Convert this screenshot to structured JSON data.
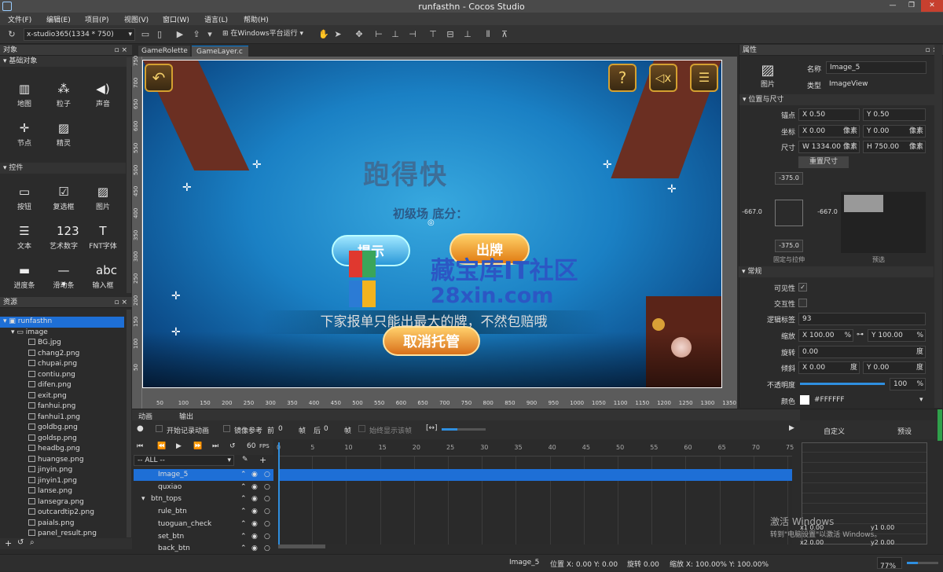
{
  "window": {
    "title": "runfasthn - Cocos Studio",
    "min": "—",
    "max": "❐",
    "close": "✕"
  },
  "menu": [
    "文件(F)",
    "编辑(E)",
    "项目(P)",
    "视图(V)",
    "窗口(W)",
    "语言(L)",
    "帮助(H)"
  ],
  "toolbar": {
    "resolution": "x-studio365(1334 * 750)",
    "run_target": "在Windows平台运行"
  },
  "objects_panel": {
    "title": "对象",
    "sec_basic": "基础对象",
    "basic": [
      {
        "label": "地图",
        "icon": "map-icon",
        "glyph": "▥"
      },
      {
        "label": "粒子",
        "icon": "particle-icon",
        "glyph": "⁂"
      },
      {
        "label": "声音",
        "icon": "sound-icon",
        "glyph": "◀)"
      },
      {
        "label": "节点",
        "icon": "node-icon",
        "glyph": "✛"
      },
      {
        "label": "精灵",
        "icon": "sprite-icon",
        "glyph": "▨"
      }
    ],
    "sec_controls": "控件",
    "controls": [
      {
        "label": "按钮",
        "icon": "button-icon",
        "glyph": "▭"
      },
      {
        "label": "复选框",
        "icon": "checkbox-icon",
        "glyph": "☑"
      },
      {
        "label": "图片",
        "icon": "image-icon",
        "glyph": "▨"
      },
      {
        "label": "文本",
        "icon": "text-icon",
        "glyph": "☰"
      },
      {
        "label": "艺术数字",
        "icon": "art-number-icon",
        "glyph": "123"
      },
      {
        "label": "FNT字体",
        "icon": "fnt-font-icon",
        "glyph": "T"
      },
      {
        "label": "进度条",
        "icon": "progress-icon",
        "glyph": "▬"
      },
      {
        "label": "滑动条",
        "icon": "slider-icon",
        "glyph": "—•"
      },
      {
        "label": "输入框",
        "icon": "input-box-icon",
        "glyph": "abc"
      }
    ]
  },
  "resources_panel": {
    "title": "资源",
    "root": "runfasthn",
    "folder": "image",
    "files": [
      "BG.jpg",
      "chang2.png",
      "chupai.png",
      "contiu.png",
      "difen.png",
      "exit.png",
      "fanhui.png",
      "fanhui1.png",
      "goldbg.png",
      "goldsp.png",
      "headbg.png",
      "huangse.png",
      "jinyin.png",
      "jinyin1.png",
      "lanse.png",
      "lansegra.png",
      "outcardtip2.png",
      "paials.png",
      "panel_result.png"
    ]
  },
  "tabs": [
    {
      "label": "GameRolette"
    },
    {
      "label": "GameLayer.c"
    }
  ],
  "tab_close": "×",
  "game": {
    "logo": "跑得快",
    "base_score": "初级场 底分：",
    "hint": "提示",
    "play": "出牌",
    "notice": "下家报单只能出最大的牌，不然包赔哦",
    "cancel_auto": "取消托管",
    "help": "?",
    "mute": "◁x",
    "menu": "☰",
    "back": "↶"
  },
  "watermark": {
    "line1": "藏宝库IT社区",
    "line2": "28xin.com"
  },
  "ruler_h": [
    "50",
    "100",
    "150",
    "200",
    "250",
    "300",
    "350",
    "400",
    "450",
    "500",
    "550",
    "600",
    "650",
    "700",
    "750",
    "800",
    "850",
    "900",
    "950",
    "1000",
    "1050",
    "1100",
    "1150",
    "1200",
    "1250",
    "1300",
    "1350"
  ],
  "ruler_v": [
    "750",
    "700",
    "650",
    "600",
    "550",
    "500",
    "450",
    "400",
    "350",
    "300",
    "250",
    "200",
    "150",
    "100",
    "50"
  ],
  "properties": {
    "title": "属性",
    "type_icon_label": "图片",
    "name_label": "名称",
    "name": "Image_5",
    "type_label": "类型",
    "type": "ImageView",
    "sec_pos": "位置与尺寸",
    "anchor_label": "锚点",
    "anchor_x": "X 0.50",
    "anchor_y": "Y 0.50",
    "pos_label": "坐标",
    "pos_x": "X 0.00",
    "pos_y": "Y 0.00",
    "pos_unit": "像素",
    "size_label": "尺寸",
    "size_w": "W 1334.00",
    "size_h": "H 750.00",
    "size_unit": "像素",
    "reset_size": "重置尺寸",
    "margin_top": "-375.0",
    "margin_left": "-667.0",
    "margin_right": "-667.0",
    "margin_bottom": "-375.0",
    "layout_label": "固定与拉伸",
    "preview_label": "预选",
    "sec_general": "常规",
    "visible_label": "可见性",
    "interactive_label": "交互性",
    "tag_label": "逻辑标签",
    "tag": "93",
    "scale_label": "缩放",
    "scale_x": "X 100.00",
    "scale_y": "Y 100.00",
    "pct": "%",
    "rotation_label": "旋转",
    "rotation": "0.00",
    "deg": "度",
    "skew_label": "倾斜",
    "skew_x": "X 0.00",
    "skew_y": "Y 0.00",
    "opacity_label": "不透明度",
    "opacity": "100",
    "opacity_value": 100,
    "color_label": "颜色",
    "color": "#FFFFFF"
  },
  "animation": {
    "tab1": "动画",
    "tab2": "输出",
    "record": "开始记录动画",
    "mirror": "镜像参考",
    "prev": "前",
    "prev_v": "0",
    "frame1": "帧",
    "next": "后",
    "next_v": "0",
    "frame2": "帧",
    "onion": "始终显示该帧",
    "fps": "60",
    "fps_label": "FPS",
    "filter": "-- ALL --",
    "custom": "自定义",
    "preset": "预设",
    "ticks": [
      "0",
      "5",
      "10",
      "15",
      "20",
      "25",
      "30",
      "35",
      "40",
      "45",
      "50",
      "55",
      "60",
      "65",
      "70",
      "75"
    ],
    "rows": [
      {
        "name": "Image_5",
        "indent": 31,
        "sel": true
      },
      {
        "name": "quxiao",
        "indent": 31,
        "sel": false
      },
      {
        "name": "btn_tops",
        "indent": 22,
        "sel": false
      },
      {
        "name": "rule_btn",
        "indent": 31,
        "sel": false
      },
      {
        "name": "tuoguan_check",
        "indent": 31,
        "sel": false
      },
      {
        "name": "set_btn",
        "indent": 31,
        "sel": false
      },
      {
        "name": "back_btn",
        "indent": 31,
        "sel": false
      }
    ],
    "curve": {
      "x1": "x1  0.00",
      "y1": "y1  0.00",
      "x2": "x2  0.00",
      "y2": "y2  0.00"
    },
    "activate1": "激活 Windows",
    "activate2": "转到\"电脑设置\"以激活 Windows。"
  },
  "status": {
    "name": "Image_5",
    "pos": "位置 X: 0.00  Y: 0.00",
    "rotation": "旋转 0.00",
    "scale": "缩放 X: 100.00%  Y: 100.00%",
    "zoom": "77%"
  },
  "colors": {
    "accent": "#0078d7",
    "selection": "#1e6fd6",
    "stage": "#1a80c4"
  }
}
